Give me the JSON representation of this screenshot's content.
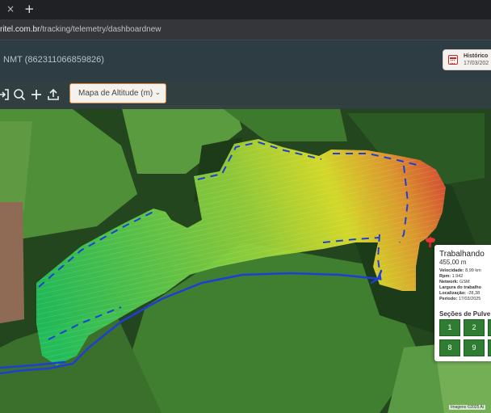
{
  "browser": {
    "tab_close": "×",
    "tab_new": "+",
    "url_host": "ritel.com.br",
    "url_path": "/tracking/telemetry/dashboardnew"
  },
  "header": {
    "device_title": "NMT (862311066859826)",
    "history_label": "Histórico",
    "history_date": "17/03/202"
  },
  "toolbar": {
    "icons": [
      "login-icon",
      "search-icon",
      "plus-icon",
      "upload-icon"
    ],
    "map_select_value": "Mapa de Altitude (m)",
    "accent_color": "#e0843c"
  },
  "popup": {
    "status": "Trabalhando",
    "altitude": "455,00 m",
    "fields": [
      {
        "label": "Velocidade:",
        "value": "8,99 km"
      },
      {
        "label": "Rpm:",
        "value": "1.942"
      },
      {
        "label": "Network:",
        "value": "GSM"
      },
      {
        "label": "Largura do trabalho",
        "value": ""
      },
      {
        "label": "Localização:",
        "value": "-28,38"
      },
      {
        "label": "Período:",
        "value": "17/03/2025"
      }
    ],
    "sections_title": "Seções de Pulve",
    "section_buttons": [
      "1",
      "2",
      "",
      "8",
      "9",
      ""
    ],
    "section_color": "#2e7d32"
  },
  "map": {
    "legend_colors": {
      "low": "#22c55e",
      "mid": "#e6e82a",
      "high": "#e53935"
    },
    "track_color": "#1e3fd6",
    "attribution": "Imagens ©2025 Ai"
  }
}
